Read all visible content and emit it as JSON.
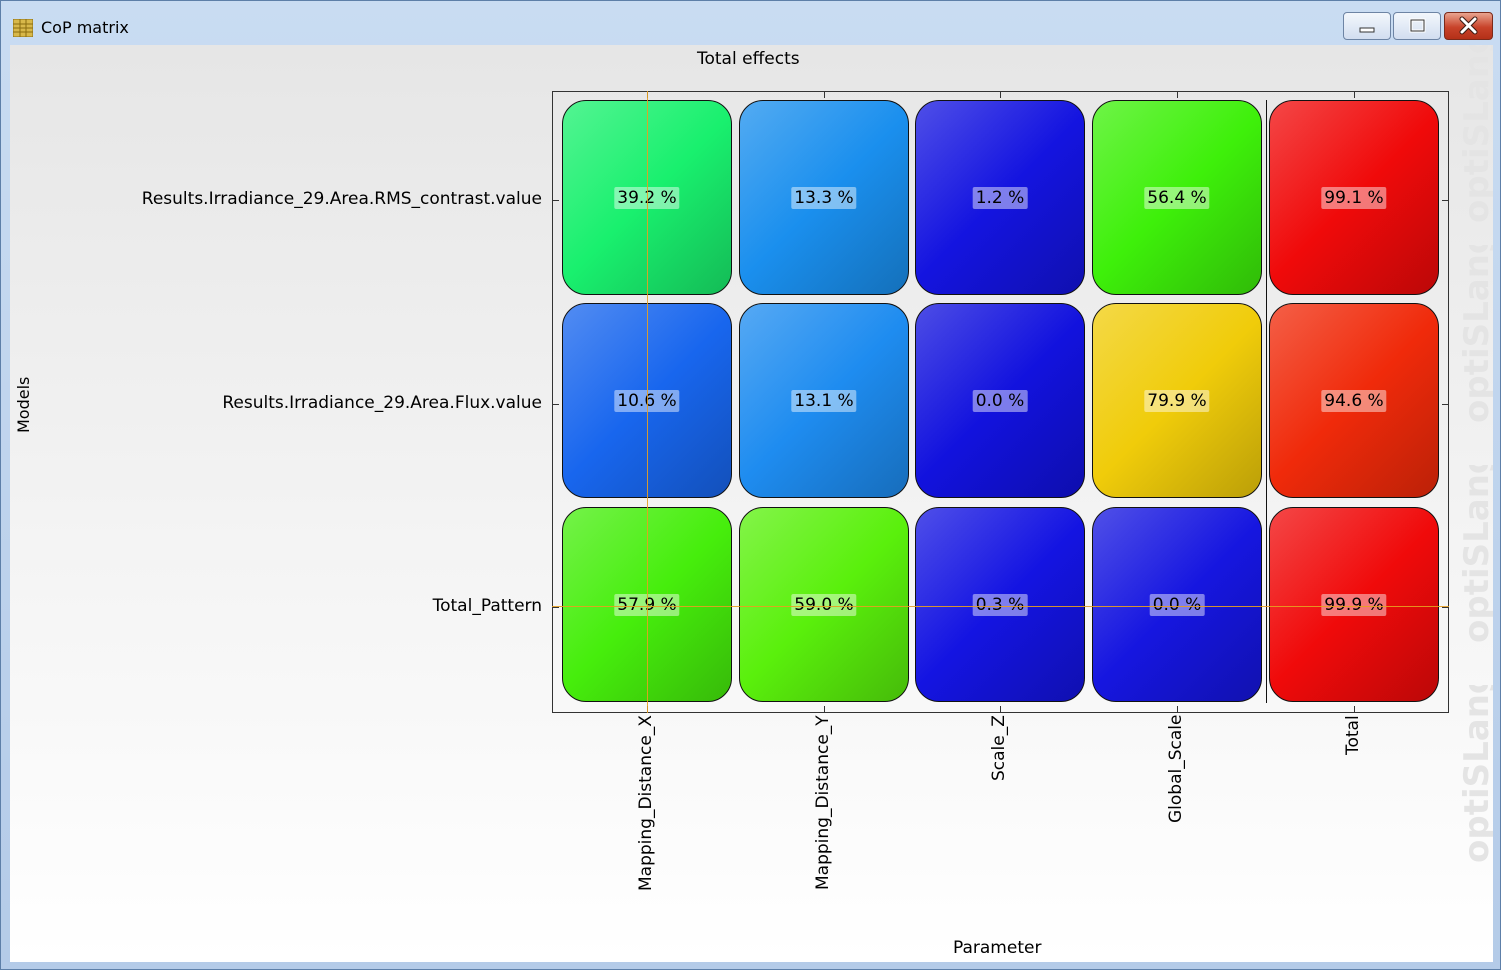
{
  "window": {
    "title": "CoP matrix",
    "buttons": {
      "minimize": "minimize",
      "maximize": "maximize",
      "close": "close"
    }
  },
  "watermark": "optiSLang",
  "chart": {
    "title": "Total effects",
    "ylabel": "Models",
    "xlabel": "Parameter"
  },
  "chart_data": {
    "type": "heatmap",
    "title": "Total effects",
    "xlabel": "Parameter",
    "ylabel": "Models",
    "columns": [
      "Mapping_Distance_X",
      "Mapping_Distance_Y",
      "Scale_Z",
      "Global_Scale",
      "Total"
    ],
    "rows": [
      "Results.Irradiance_29.Area.RMS_contrast.value",
      "Results.Irradiance_29.Area.Flux.value",
      "Total_Pattern"
    ],
    "values": [
      [
        39.2,
        13.3,
        1.2,
        56.4,
        99.1
      ],
      [
        10.6,
        13.1,
        0.0,
        79.9,
        94.6
      ],
      [
        57.9,
        59.0,
        0.3,
        0.0,
        99.9
      ]
    ],
    "labels": [
      [
        "39.2 %",
        "13.3 %",
        "1.2 %",
        "56.4 %",
        "99.1 %"
      ],
      [
        "10.6 %",
        "13.1 %",
        "0.0 %",
        "79.9 %",
        "94.6 %"
      ],
      [
        "57.9 %",
        "59.0 %",
        "0.3 %",
        "0.0 %",
        "99.9 %"
      ]
    ],
    "colors": [
      [
        "#19f06e",
        "#1a8fee",
        "#1414e0",
        "#3ef00a",
        "#f00a0a"
      ],
      [
        "#1866ee",
        "#1e8cf0",
        "#1212de",
        "#f0cc0a",
        "#f02a0a"
      ],
      [
        "#46ee0c",
        "#5af00c",
        "#1414e2",
        "#1616e0",
        "#f00a0a"
      ]
    ],
    "crosshair": {
      "column": "Mapping_Distance_X",
      "row": "Total_Pattern"
    }
  }
}
